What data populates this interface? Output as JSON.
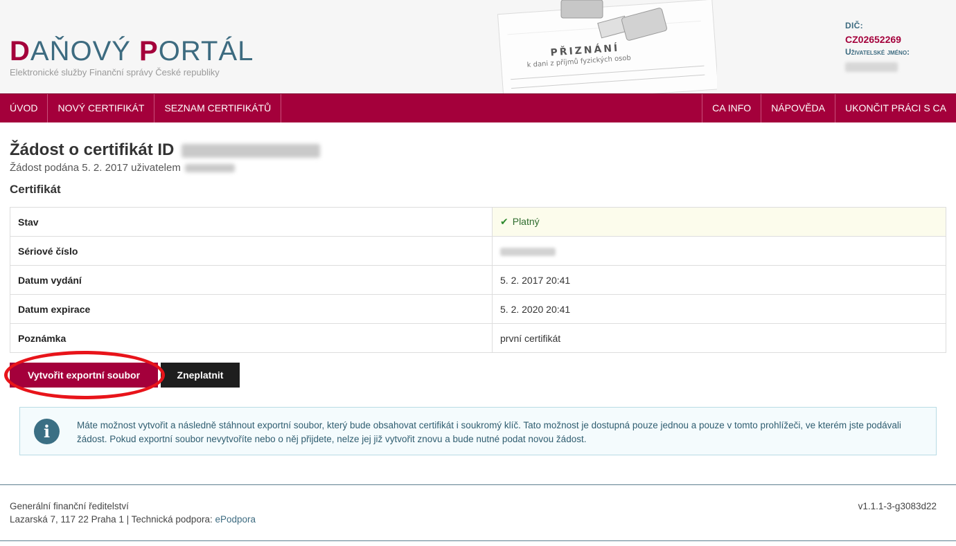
{
  "header": {
    "logo": {
      "p1_initial": "D",
      "p1_rest": "AŇOVÝ ",
      "p2_initial": "P",
      "p2_rest": "ORTÁL"
    },
    "subtitle": "Elektronické služby Finanční správy České republiky",
    "deco_title": "PŘIZNÁNÍ",
    "deco_sub": "k dani z příjmů fyzických osob",
    "user": {
      "dic_label": "DIČ:",
      "dic_value": "CZ02652269",
      "username_label": "Uživatelské jméno:"
    }
  },
  "nav": {
    "left": [
      "Úvod",
      "Nový certifikát",
      "Seznam certifikátů"
    ],
    "right": [
      "CA info",
      "Nápověda",
      "Ukončit práci s CA"
    ]
  },
  "request": {
    "title_prefix": "Žádost o certifikát ID",
    "meta_prefix": "Žádost podána 5. 2. 2017 uživatelem"
  },
  "certificate": {
    "section_title": "Certifikát",
    "rows": [
      {
        "label": "Stav",
        "value": "Platný",
        "status": "ok"
      },
      {
        "label": "Sériové číslo",
        "value": ""
      },
      {
        "label": "Datum vydání",
        "value": "5. 2. 2017 20:41"
      },
      {
        "label": "Datum expirace",
        "value": "5. 2. 2020 20:41"
      },
      {
        "label": "Poznámka",
        "value": "první certifikát"
      }
    ]
  },
  "actions": {
    "export_label": "Vytvořit exportní soubor",
    "revoke_label": "Zneplatnit"
  },
  "alert": {
    "text": "Máte možnost vytvořit a následně stáhnout exportní soubor, který bude obsahovat certifikát i soukromý klíč. Tato možnost je dostupná pouze jednou a pouze v tomto prohlížeči, ve kterém jste podávali žádost. Pokud exportní soubor nevytvoříte nebo o něj přijdete, nelze jej již vytvořit znovu a bude nutné podat novou žádost."
  },
  "footer": {
    "org": "Generální finanční ředitelství",
    "address": "Lazarská 7, 117 22 Praha 1 | Technická podpora: ",
    "support_link": "ePodpora",
    "version": "v1.1.1-3-g3083d22"
  },
  "colors": {
    "brand": "#a4003b",
    "accent": "#3d6b80",
    "ok_green": "#2d8a2d",
    "ring": "#e8141a"
  }
}
